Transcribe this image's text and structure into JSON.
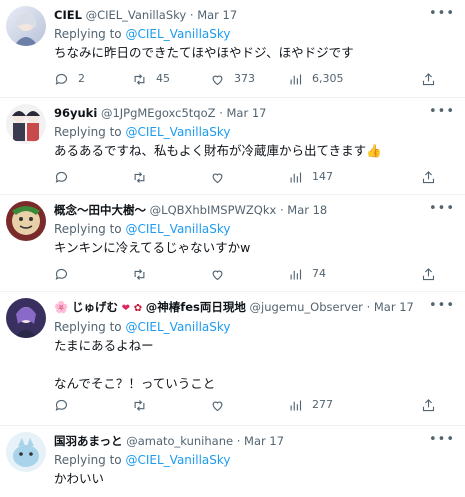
{
  "replying_label": "Replying to",
  "tweets": [
    {
      "name": "CIEL",
      "handle": "@CIEL_VanillaSky",
      "date": "Mar 17",
      "reply_to": "@CIEL_VanillaSky",
      "text": "ちなみに昨日のできたてほやほやドジ、ほやドジです",
      "replies": "2",
      "retweets": "45",
      "likes": "373",
      "views": "6,305"
    },
    {
      "name": "96yuki",
      "handle": "@1JPgMEgoxc5tqoZ",
      "date": "Mar 17",
      "reply_to": "@CIEL_VanillaSky",
      "text": "あるあるですね、私もよく財布が冷蔵庫から出てきます",
      "emoji": "👍",
      "replies": "",
      "retweets": "",
      "likes": "",
      "views": "147"
    },
    {
      "name": "概念〜田中大樹〜",
      "handle": "@LQBXhbIMSPWZQkx",
      "date": "Mar 18",
      "reply_to": "@CIEL_VanillaSky",
      "text": "キンキンに冷えてるじゃないすかw",
      "replies": "",
      "retweets": "",
      "likes": "",
      "views": "74"
    },
    {
      "name_prefix": "🌸",
      "name": "じゅげむ",
      "name_suffix": "@神椿fes両日現地",
      "handle": "@jugemu_Observer",
      "date": "Mar 17",
      "reply_to": "@CIEL_VanillaSky",
      "text": "たまにあるよねー\n\nなんでそこ？！っていうこと",
      "replies": "",
      "retweets": "",
      "likes": "",
      "views": "277"
    },
    {
      "name": "国羽あまっと",
      "handle": "@amato_kunihane",
      "date": "Mar 17",
      "reply_to": "@CIEL_VanillaSky",
      "text": "かわいい"
    }
  ],
  "icons": {
    "reply": "reply-icon",
    "retweet": "retweet-icon",
    "like": "like-icon",
    "views": "views-icon",
    "share": "share-icon",
    "more": "more-icon"
  },
  "colors": {
    "link": "#1d9bf0",
    "muted": "#536471",
    "text": "#0f1419",
    "divider": "#eff3f4"
  }
}
